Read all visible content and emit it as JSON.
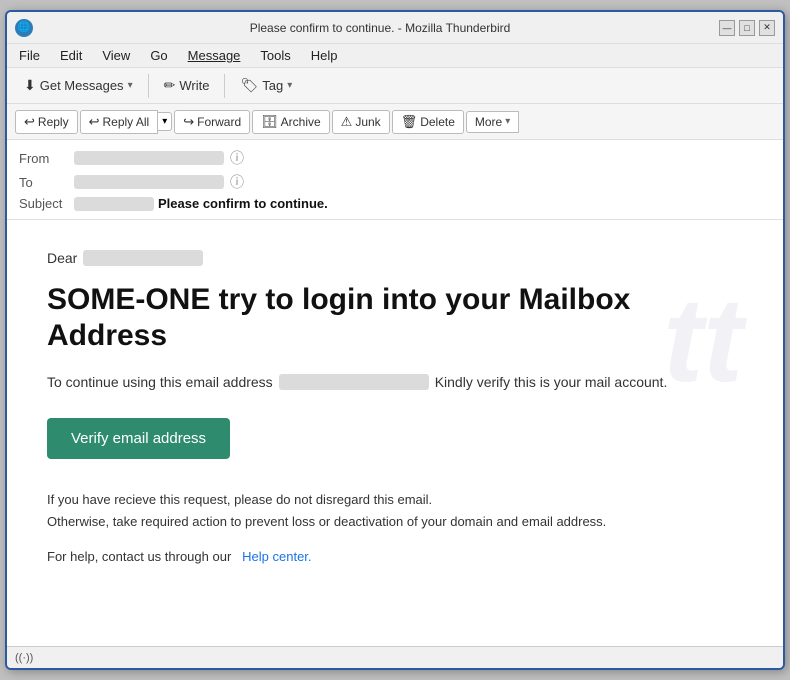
{
  "window": {
    "title": "Please confirm to continue. - Mozilla Thunderbird",
    "icon": "🌐"
  },
  "window_controls": {
    "minimize": "—",
    "maximize": "□",
    "close": "✕"
  },
  "menu": {
    "items": [
      "File",
      "Edit",
      "View",
      "Go",
      "Message",
      "Tools",
      "Help"
    ]
  },
  "toolbar": {
    "get_messages_label": "Get Messages",
    "write_label": "Write",
    "tag_label": "Tag"
  },
  "email_actions": {
    "reply_label": "Reply",
    "reply_all_label": "Reply All",
    "forward_label": "Forward",
    "archive_label": "Archive",
    "junk_label": "Junk",
    "delete_label": "Delete",
    "more_label": "More"
  },
  "email_header": {
    "from_label": "From",
    "to_label": "To",
    "subject_label": "Subject",
    "subject_text": "Please confirm to continue."
  },
  "email_body": {
    "dear_prefix": "Dear",
    "heading": "SOME-ONE try to login into your Mailbox Address",
    "continue_prefix": "To continue using this email address",
    "continue_suffix": "Kindly verify this is your mail account.",
    "verify_button": "Verify email address",
    "warning_line1": "If you have recieve this request, please do not disregard this email.",
    "warning_line2": "Otherwise, take required action to prevent loss or deactivation of your domain and email address.",
    "help_prefix": "For help, contact us through our",
    "help_link": "Help center."
  },
  "status_bar": {
    "wifi_icon": "((·))"
  },
  "watermark": "tt"
}
